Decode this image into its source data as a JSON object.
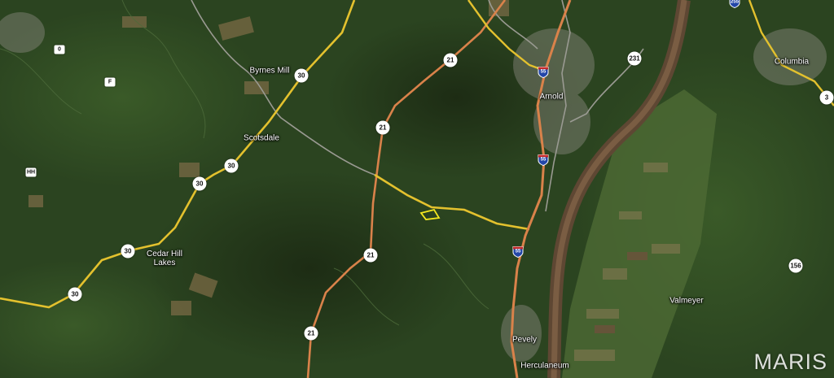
{
  "places": {
    "byrnes_mill": "Byrnes Mill",
    "scotsdale": "Scotsdale",
    "cedar_hill_lakes_line1": "Cedar Hill",
    "cedar_hill_lakes_line2": "Lakes",
    "arnold": "Arnold",
    "columbia": "Columbia",
    "valmeyer": "Valmeyer",
    "pevely": "Pevely",
    "herculaneum": "Herculaneum"
  },
  "route_shields": {
    "r30_a": "30",
    "r30_b": "30",
    "r30_c": "30",
    "r30_d": "30",
    "r30_e": "30",
    "r21_a": "21",
    "r21_b": "21",
    "r21_c": "21",
    "r21_d": "21",
    "r231": "231",
    "r156": "156",
    "r3": "3",
    "r0": "0",
    "rF": "F",
    "rHH": "HH"
  },
  "interstate_shields": {
    "i55_a": "55",
    "i55_b": "55",
    "i55_c": "55",
    "i255": "255"
  },
  "brand": "MARIS",
  "colors": {
    "forest": "#2b4420",
    "river": "#6b4d35",
    "highway_yellow": "#e3c12e",
    "parcel_outline": "#f4e81f",
    "interstate_blue": "#2346a8"
  }
}
